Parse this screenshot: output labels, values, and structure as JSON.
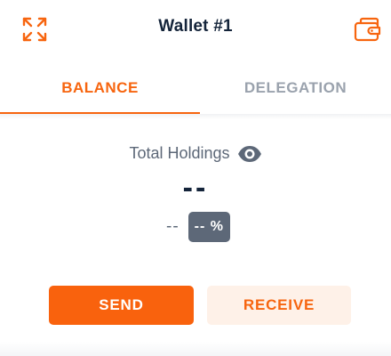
{
  "header": {
    "title": "Wallet #1",
    "expand_icon": "expand-arrows-icon",
    "wallets_icon": "wallets-icon"
  },
  "tabs": [
    {
      "label": "BALANCE",
      "active": true
    },
    {
      "label": "DELEGATION",
      "active": false
    }
  ],
  "holdings": {
    "label": "Total Holdings",
    "visibility_icon": "eye-icon",
    "value": "--",
    "change_value": "--",
    "change_percent": "-- %"
  },
  "actions": {
    "send_label": "SEND",
    "receive_label": "RECEIVE"
  },
  "colors": {
    "accent": "#f7650f",
    "title": "#14243a",
    "muted": "#5d6878",
    "inactive_tab": "#9aa2ad",
    "receive_bg": "#fef1e8"
  }
}
